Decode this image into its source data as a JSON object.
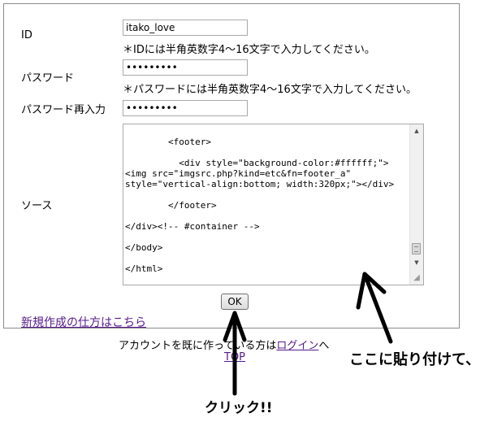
{
  "form": {
    "id_label": "ID",
    "id_value": "itako_love",
    "id_note": "＊IDには半角英数字4～16文字で入力してください。",
    "password_label": "パスワード",
    "password_value": "•••••••••",
    "password_note": "＊パスワードには半角英数字4～16文字で入力してください。",
    "password_confirm_label": "パスワード再入力",
    "password_confirm_value": "•••••••••",
    "source_label": "ソース",
    "source_value": "\n        <footer>\n\n          <div style=\"background-color:#ffffff;\">\n<img src=\"imgsrc.php?kind=etc&fn=footer_a\"\nstyle=\"vertical-align:bottom; width:320px;\"></div>\n\n        </footer>\n\n</div><!-- #container -->\n\n</body>\n\n</html>",
    "ok_label": "OK"
  },
  "links": {
    "help": "新規作成の仕方はこちら",
    "account_prefix": "アカウントを既に作っている方は",
    "login": "ログイン",
    "account_suffix": "へ",
    "top": "TOP"
  },
  "annotations": {
    "paste_here": "ここに貼り付けて、",
    "click": "クリック!!"
  },
  "icons": {
    "scroll_up": "scroll-up-arrow-icon",
    "scroll_down": "scroll-down-arrow-icon",
    "resize": "resize-grip-icon"
  }
}
